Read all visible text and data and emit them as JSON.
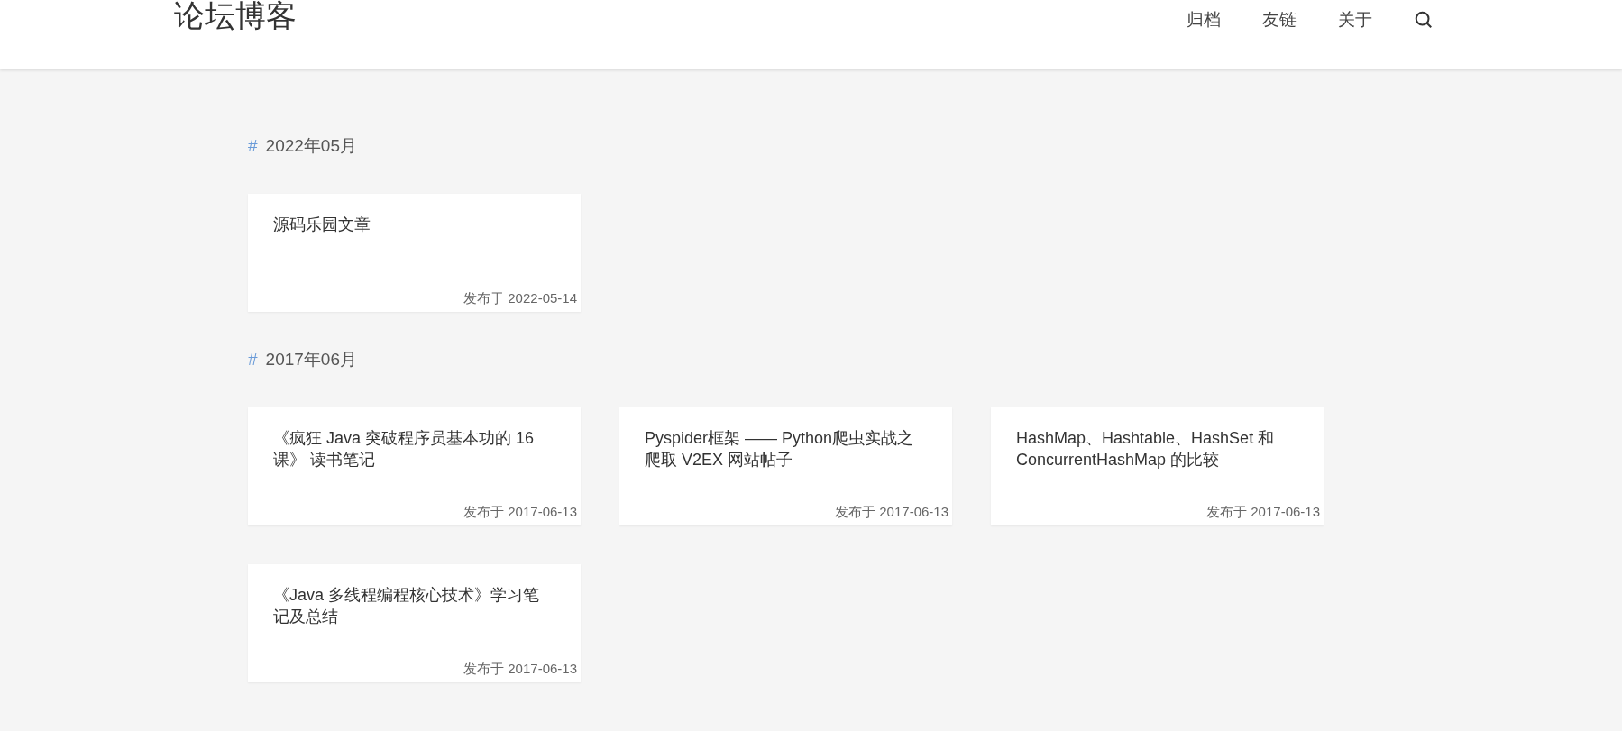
{
  "header": {
    "title": "论坛博客",
    "nav": [
      "归档",
      "友链",
      "关于"
    ]
  },
  "sections": [
    {
      "marker": "#",
      "heading": "2022年05月",
      "posts": [
        {
          "title": "源码乐园文章",
          "date": "发布于 2022-05-14"
        }
      ]
    },
    {
      "marker": "#",
      "heading": "2017年06月",
      "posts": [
        {
          "title": "《疯狂 Java 突破程序员基本功的 16 课》 读书笔记",
          "date": "发布于 2017-06-13"
        },
        {
          "title": "Pyspider框架 —— Python爬虫实战之爬取 V2EX 网站帖子",
          "date": "发布于 2017-06-13"
        },
        {
          "title": "HashMap、Hashtable、HashSet 和 ConcurrentHashMap 的比较",
          "date": "发布于 2017-06-13"
        },
        {
          "title": "《Java 多线程编程核心技术》学习笔记及总结",
          "date": "发布于 2017-06-13"
        }
      ]
    }
  ]
}
